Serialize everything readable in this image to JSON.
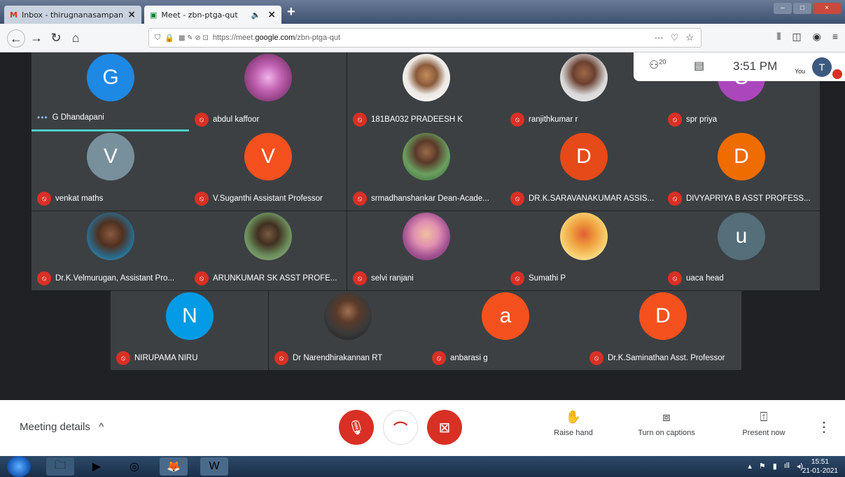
{
  "browser": {
    "tabs": [
      {
        "title": "Inbox - thirugnanasampandam",
        "favicon": "gmail-icon",
        "active": false
      },
      {
        "title": "Meet - zbn-ptga-qut",
        "favicon": "meet-icon",
        "active": true,
        "audio": true
      }
    ],
    "url_prefix": "https://meet.",
    "url_domain": "google.com",
    "url_path": "/zbn-ptga-qut"
  },
  "meet": {
    "participant_count": "20",
    "time": "3:51 PM",
    "self_label": "You",
    "self_initial": "T",
    "participants": [
      {
        "name": "G Dhandapani",
        "initial": "G",
        "color": "#1e88e5",
        "speaking": true
      },
      {
        "name": "abdul kaffoor",
        "photo": "p1"
      },
      {
        "name": "181BA032 PRADEESH K",
        "photo": "p2"
      },
      {
        "name": "ranjithkumar r",
        "photo": "p3"
      },
      {
        "name": "spr priya",
        "initial": "S",
        "color": "#ab47bc"
      },
      {
        "name": "venkat maths",
        "initial": "V",
        "color": "#78909c"
      },
      {
        "name": "V.Suganthi Assistant Professor",
        "initial": "V",
        "color": "#f4511e"
      },
      {
        "name": "srmadhanshankar Dean-Acade...",
        "photo": "p4"
      },
      {
        "name": "DR.K.SARAVANAKUMAR ASSIS...",
        "initial": "D",
        "color": "#e64a19"
      },
      {
        "name": "DIVYAPRIYA B ASST PROFESS...",
        "initial": "D",
        "color": "#ef6c00"
      },
      {
        "name": "Dr.K.Velmurugan, Assistant Pro...",
        "photo": "p5"
      },
      {
        "name": "ARUNKUMAR SK ASST PROFE...",
        "photo": "p6"
      },
      {
        "name": "selvi ranjani",
        "photo": "p7"
      },
      {
        "name": "Sumathi P",
        "photo": "p8"
      },
      {
        "name": "uaca head",
        "initial": "u",
        "color": "#546e7a"
      },
      {
        "name": "NIRUPAMA NIRU",
        "initial": "N",
        "color": "#039be5"
      },
      {
        "name": "Dr Narendhirakannan RT",
        "photo": "p9"
      },
      {
        "name": "anbarasi g",
        "initial": "a",
        "color": "#f4511e"
      },
      {
        "name": "Dr.K.Saminathan Asst. Professor",
        "initial": "D",
        "color": "#f4511e"
      }
    ]
  },
  "controls": {
    "meeting_details": "Meeting details",
    "raise_hand": "Raise hand",
    "captions": "Turn on captions",
    "present": "Present now"
  },
  "taskbar": {
    "time": "15:51",
    "date": "21-01-2021"
  }
}
